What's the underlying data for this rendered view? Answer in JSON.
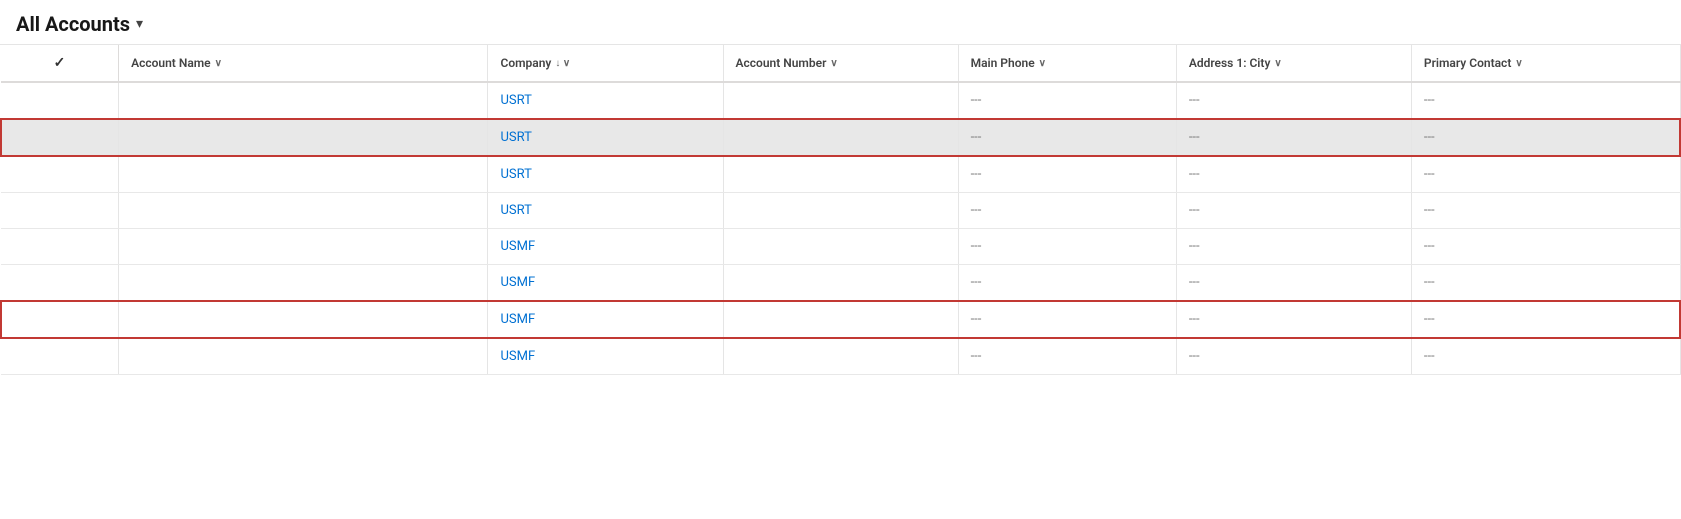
{
  "header": {
    "title": "All Accounts",
    "chevron": "▾"
  },
  "columns": [
    {
      "id": "check",
      "label": "",
      "sortable": false
    },
    {
      "id": "account-name",
      "label": "Account Name",
      "sortable": true,
      "sort_dir": ""
    },
    {
      "id": "company",
      "label": "Company",
      "sortable": true,
      "sort_dir": "↓"
    },
    {
      "id": "account-number",
      "label": "Account Number",
      "sortable": true,
      "sort_dir": ""
    },
    {
      "id": "main-phone",
      "label": "Main Phone",
      "sortable": true,
      "sort_dir": ""
    },
    {
      "id": "address-city",
      "label": "Address 1: City",
      "sortable": true,
      "sort_dir": ""
    },
    {
      "id": "primary-contact",
      "label": "Primary Contact",
      "sortable": true,
      "sort_dir": ""
    }
  ],
  "rows": [
    {
      "id": "row-1",
      "check": "",
      "account_name": "",
      "company": "USRT",
      "account_number": "",
      "main_phone": "---",
      "address_city": "---",
      "primary_contact": "---",
      "highlighted": false,
      "red_border": false
    },
    {
      "id": "row-2",
      "check": "",
      "account_name": "",
      "company": "USRT",
      "account_number": "",
      "main_phone": "---",
      "address_city": "---",
      "primary_contact": "---",
      "highlighted": true,
      "red_border": true
    },
    {
      "id": "row-3",
      "check": "",
      "account_name": "",
      "company": "USRT",
      "account_number": "",
      "main_phone": "---",
      "address_city": "---",
      "primary_contact": "---",
      "highlighted": false,
      "red_border": false
    },
    {
      "id": "row-4",
      "check": "",
      "account_name": "",
      "company": "USRT",
      "account_number": "",
      "main_phone": "---",
      "address_city": "---",
      "primary_contact": "---",
      "highlighted": false,
      "red_border": false
    },
    {
      "id": "row-5",
      "check": "",
      "account_name": "",
      "company": "USMF",
      "account_number": "",
      "main_phone": "---",
      "address_city": "---",
      "primary_contact": "---",
      "highlighted": false,
      "red_border": false
    },
    {
      "id": "row-6",
      "check": "",
      "account_name": "",
      "company": "USMF",
      "account_number": "",
      "main_phone": "---",
      "address_city": "---",
      "primary_contact": "---",
      "highlighted": false,
      "red_border": false
    },
    {
      "id": "row-7",
      "check": "",
      "account_name": "",
      "company": "USMF",
      "account_number": "",
      "main_phone": "---",
      "address_city": "---",
      "primary_contact": "---",
      "highlighted": false,
      "red_border": true
    },
    {
      "id": "row-8",
      "check": "",
      "account_name": "",
      "company": "USMF",
      "account_number": "",
      "main_phone": "---",
      "address_city": "---",
      "primary_contact": "---",
      "highlighted": false,
      "red_border": false
    }
  ],
  "empty_value": "---",
  "check_symbol": "✓"
}
